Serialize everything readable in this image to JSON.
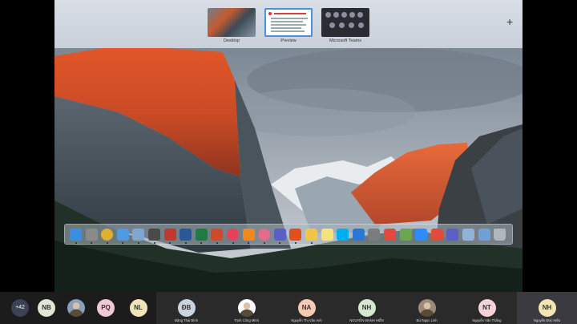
{
  "mission_control": {
    "spaces": [
      {
        "label": "Desktop"
      },
      {
        "label": "Preview"
      },
      {
        "label": "Microsoft Teams"
      }
    ],
    "add_space_label": "+"
  },
  "dock": {
    "apps": [
      "finder",
      "launchpad",
      "chrome",
      "mail",
      "3d-viewer",
      "terminal",
      "zotero",
      "word",
      "excel",
      "powerpoint",
      "music",
      "vlc",
      "photos",
      "teams",
      "office",
      "notes",
      "stickies",
      "skype",
      "zalo",
      "system-preferences",
      "calendar",
      "photos-2",
      "video",
      "calendar-2",
      "teams-2",
      "mirror",
      "preview",
      "trash"
    ]
  },
  "participants": {
    "more_count": "+42",
    "list": [
      {
        "initials": "NB",
        "name": "",
        "color": "#dfe6d6"
      },
      {
        "initials": "",
        "name": "",
        "color": "#8aa0b8"
      },
      {
        "initials": "PQ",
        "name": "",
        "color": "#f2c8d4"
      },
      {
        "initials": "NL",
        "name": "",
        "color": "#efe4b8"
      },
      {
        "initials": "ĐB",
        "name": "Đặng Thái Bình",
        "color": "#c9d4de"
      },
      {
        "initials": "",
        "name": "Trịnh Công Minh",
        "color": "#ffffff"
      },
      {
        "initials": "NA",
        "name": "Nguyễn Thị Vân Anh",
        "color": "#f5c9b3"
      },
      {
        "initials": "NH",
        "name": "NGUYỄN MẠNH HIỂN",
        "color": "#d6e7cf"
      },
      {
        "initials": "",
        "name": "Bùi Ngọc Linh",
        "color": "#9c8a78"
      },
      {
        "initials": "NT",
        "name": "Nguyễn Văn Thắng",
        "color": "#f4d3d8"
      },
      {
        "initials": "NH",
        "name": "Nguyễn Đức Hiếu",
        "color": "#f3e6b5"
      }
    ]
  }
}
